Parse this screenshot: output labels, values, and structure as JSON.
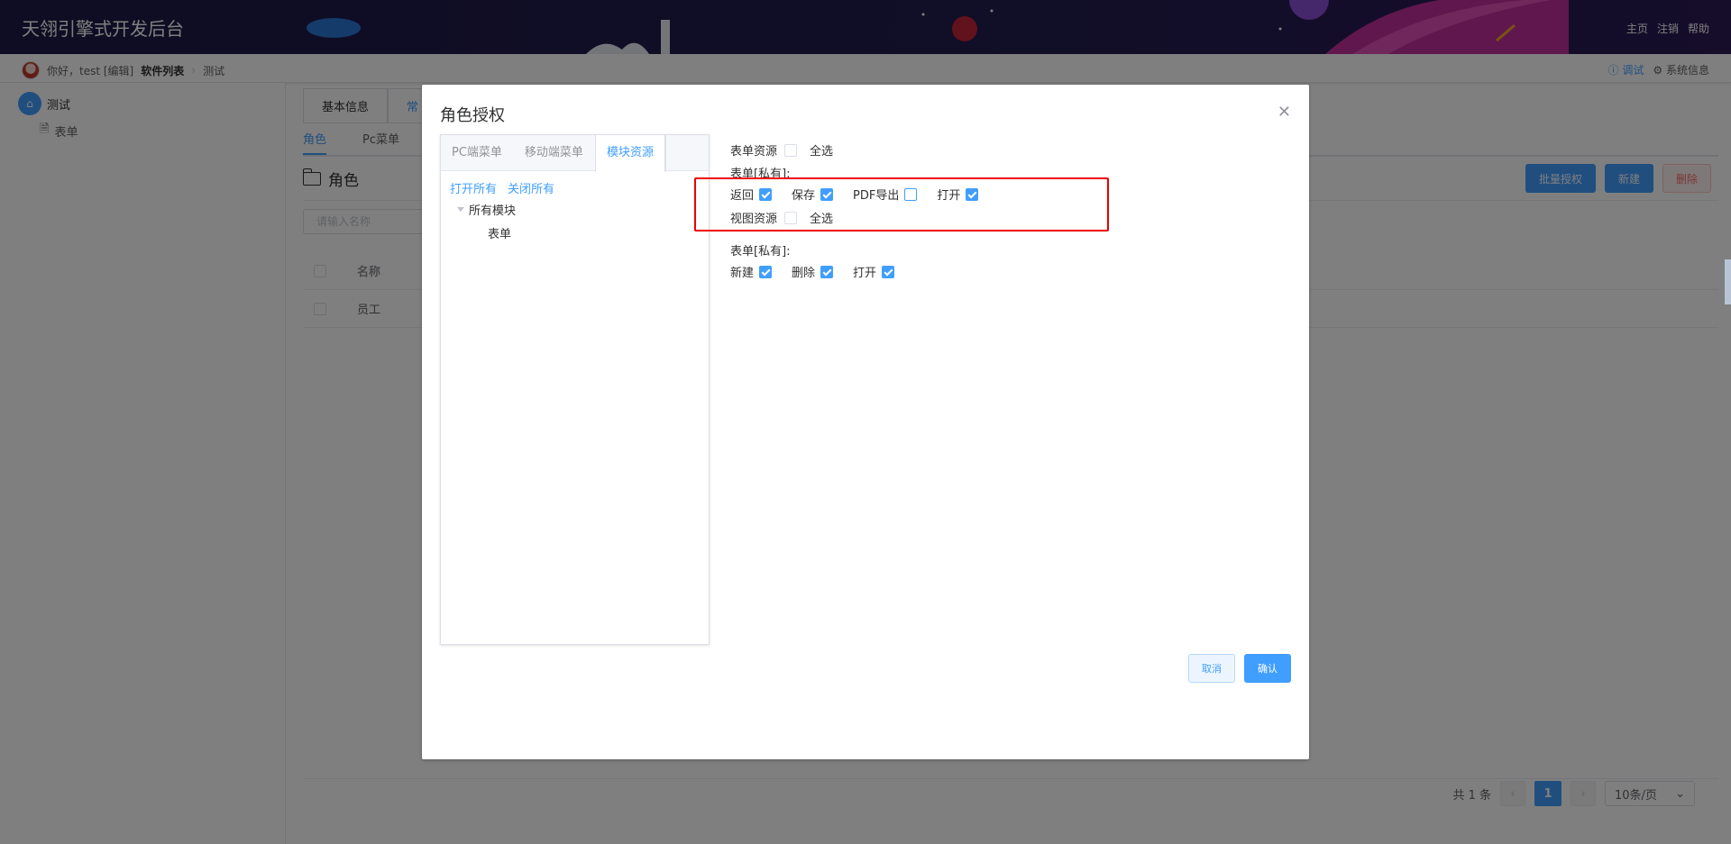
{
  "header": {
    "app_title": "天翎引擎式开发后台",
    "links": [
      "主页",
      "注销",
      "帮助"
    ]
  },
  "subbar": {
    "greeting": "你好，test [编辑]",
    "breadcrumb_software": "软件列表",
    "breadcrumb_current": "测试",
    "debug": "调试",
    "system_info": "系统信息"
  },
  "sidebar": {
    "project": "测试",
    "form": "表单"
  },
  "main": {
    "tab_basic": "基本信息",
    "tab_partial": "常",
    "subtabs": [
      "角色",
      "Pc菜单"
    ],
    "section_title": "角色",
    "buttons": {
      "batch": "批量授权",
      "new": "新建",
      "delete": "删除"
    },
    "search_placeholder": "请输入名称",
    "table_header": "名称",
    "rows": [
      "员工"
    ],
    "pager": {
      "total": "共 1 条",
      "page": "1",
      "size": "10条/页"
    }
  },
  "dialog": {
    "title": "角色授权",
    "tabs": [
      "PC端菜单",
      "移动端菜单",
      "模块资源"
    ],
    "active_tab": "模块资源",
    "open_all": "打开所有",
    "close_all": "关闭所有",
    "tree_root": "所有模块",
    "tree_leaf": "表单",
    "form_resource_label": "表单资源",
    "select_all": "全选",
    "group1_label": "表单[私有]:",
    "group1_perms": [
      {
        "label": "返回",
        "checked": true
      },
      {
        "label": "保存",
        "checked": true
      },
      {
        "label": "PDF导出",
        "checked": false
      },
      {
        "label": "打开",
        "checked": true
      }
    ],
    "view_resource_label": "视图资源",
    "group2_label": "表单[私有]:",
    "group2_perms": [
      {
        "label": "新建",
        "checked": true
      },
      {
        "label": "删除",
        "checked": true
      },
      {
        "label": "打开",
        "checked": true
      }
    ],
    "cancel": "取消",
    "confirm": "确认"
  },
  "colors": {
    "primary": "#409eff",
    "highlight_box": "#e00000",
    "header_bg": "#1d1a47"
  }
}
